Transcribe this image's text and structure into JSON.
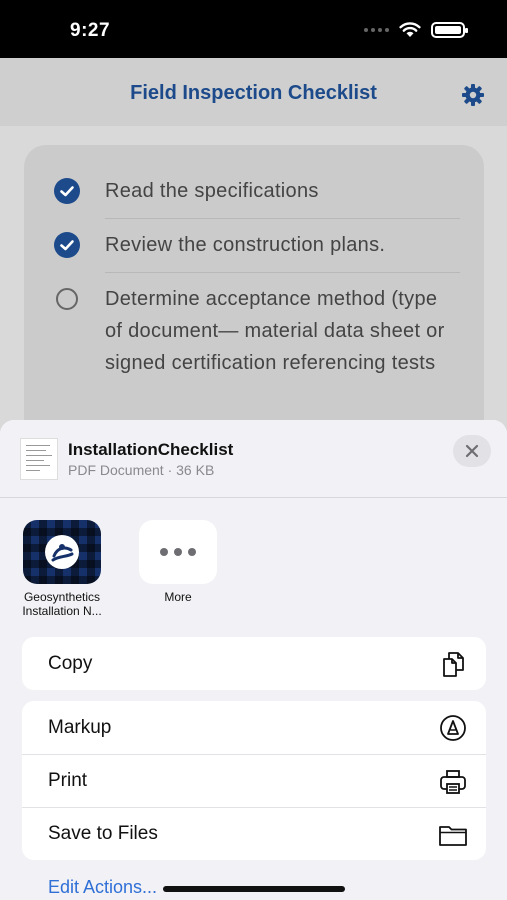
{
  "status_bar": {
    "time": "9:27"
  },
  "nav": {
    "title": "Field Inspection Checklist",
    "settings_icon": "gear-icon"
  },
  "checklist": {
    "items": [
      {
        "text": "Read the specifications",
        "checked": true
      },
      {
        "text": "Review the construction plans.",
        "checked": true
      },
      {
        "text": "Determine acceptance method (type of document— material data sheet or signed certification referencing tests",
        "checked": false
      }
    ]
  },
  "share_sheet": {
    "document": {
      "name": "InstallationChecklist",
      "subtitle": "PDF Document · 36 KB"
    },
    "apps": [
      {
        "label": "Geosynthetics Installation N...",
        "icon": "geosynthetics-app-icon"
      },
      {
        "label": "More",
        "icon": "more-icon"
      }
    ],
    "actions_primary": [
      {
        "label": "Copy",
        "icon": "copy-icon"
      }
    ],
    "actions_secondary": [
      {
        "label": "Markup",
        "icon": "markup-icon"
      },
      {
        "label": "Print",
        "icon": "printer-icon"
      },
      {
        "label": "Save to Files",
        "icon": "folder-icon"
      }
    ],
    "edit_actions_label": "Edit Actions..."
  },
  "colors": {
    "accent": "#1c4a8a",
    "link": "#2f6fd6",
    "sheet_bg": "#f2f2f6"
  }
}
